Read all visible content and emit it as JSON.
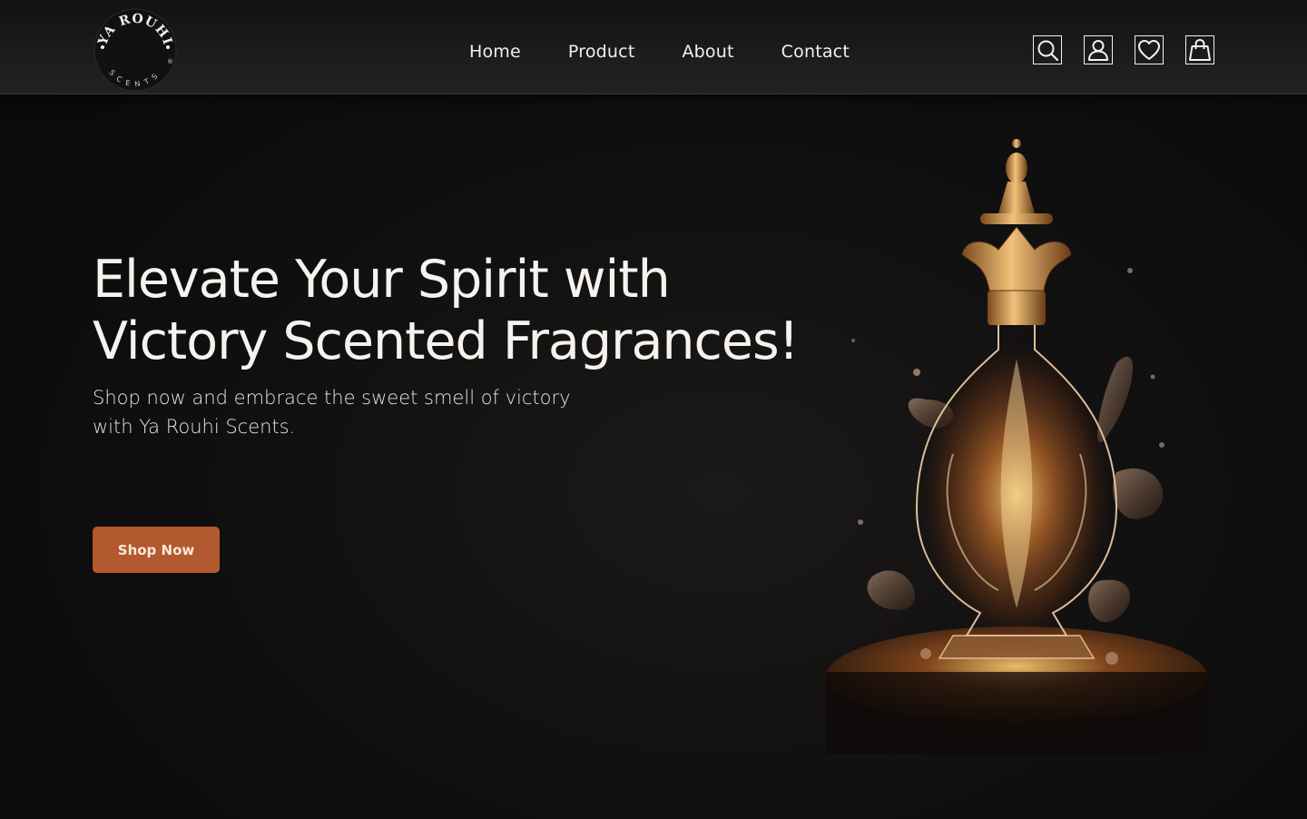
{
  "header": {
    "logo": {
      "top_text": "YA ROUHI",
      "bottom_text": "SCENTS",
      "mark": "®"
    },
    "nav": [
      {
        "label": "Home"
      },
      {
        "label": "Product"
      },
      {
        "label": "About"
      },
      {
        "label": "Contact"
      }
    ],
    "icons": [
      "search-icon",
      "user-icon",
      "heart-icon",
      "shopping-bag-icon"
    ]
  },
  "hero": {
    "title_line1": "Elevate Your Spirit with",
    "title_line2": "Victory Scented Fragrances!",
    "subtitle_line1": "Shop now and embrace the sweet smell of victory",
    "subtitle_line2": "with Ya Rouhi Scents.",
    "cta_label": "Shop Now",
    "image": "perfume-bottle-image"
  },
  "colors": {
    "background": "#0d0c0c",
    "header": "#1d1c1c",
    "accent": "#b2592f",
    "text": "#f4f1ec",
    "gold": "#d99a4a"
  }
}
